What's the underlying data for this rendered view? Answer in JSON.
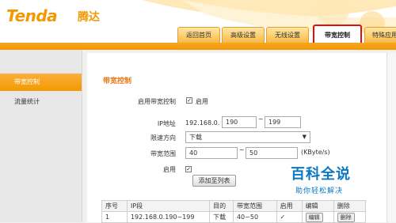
{
  "brand": {
    "logo": "Tenda",
    "logo_cn": "腾达",
    "brand_color": "#f39800"
  },
  "tabs": [
    {
      "label": "返回首页"
    },
    {
      "label": "高级设置"
    },
    {
      "label": "无线设置"
    },
    {
      "label": "带宽控制",
      "active": true
    },
    {
      "label": "特殊应用"
    }
  ],
  "sidebar": {
    "items": [
      {
        "label": "带宽控制",
        "active": true
      },
      {
        "label": "流量统计"
      }
    ]
  },
  "main": {
    "title": "带宽控制",
    "enable_bw": {
      "label": "启用带宽控制",
      "checked": true,
      "check_label": "启用"
    },
    "ip": {
      "label": "IP地址",
      "prefix": "192.168.0.",
      "start": "190",
      "sep": "~",
      "end": "199"
    },
    "direction": {
      "label": "限速方向",
      "value": "下载"
    },
    "range": {
      "label": "带宽范围",
      "min": "40",
      "sep": "~",
      "max": "50",
      "unit": "(KByte/s)"
    },
    "enable": {
      "label": "启用",
      "checked": true
    },
    "add_button": "添加至列表"
  },
  "table": {
    "headers": [
      "序号",
      "IP段",
      "目的",
      "带宽范围",
      "启用",
      "编辑",
      "删除"
    ],
    "rows": [
      {
        "no": "1",
        "ip": "192.168.0.190~199",
        "dir": "下载",
        "range": "40~50",
        "enabled": "✓",
        "edit": "编辑",
        "delete": "删除"
      }
    ]
  },
  "watermark": {
    "big": "百科全说",
    "small": "助你轻松解决"
  },
  "colors": {
    "accent": "#f39800",
    "highlight_border": "#e01010",
    "watermark": "#0b77c0"
  }
}
